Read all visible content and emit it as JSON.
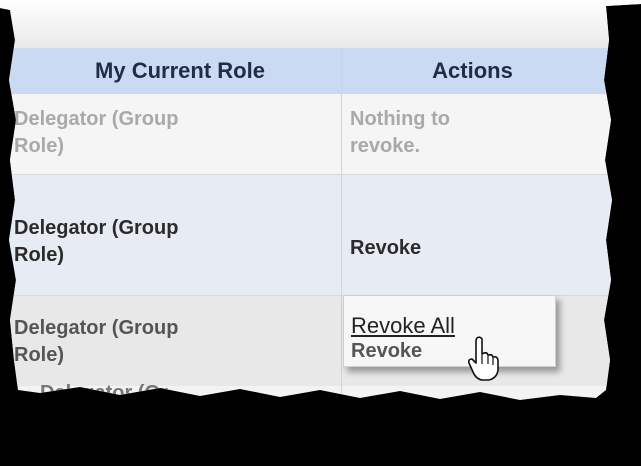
{
  "table": {
    "headers": {
      "role": "My Current Role",
      "actions": "Actions"
    },
    "rows": [
      {
        "role_line1": "Delegator (Group",
        "role_line2": "Role)",
        "action_line1": "Nothing to",
        "action_line2": "revoke."
      },
      {
        "role_line1": "Delegator (Group",
        "role_line2": "Role)",
        "action_line1": "Revoke"
      },
      {
        "role_line1": "Delegator (Group",
        "role_line2": "Role)"
      }
    ],
    "partial_row": "Delegator (Gr"
  },
  "popup_menu": {
    "items": [
      "Revoke All",
      "Revoke"
    ]
  },
  "colors": {
    "header_bg": "#c9daf2",
    "row_alt_bg": "#e7ebf3",
    "dim_text": "#a9a9a9"
  }
}
